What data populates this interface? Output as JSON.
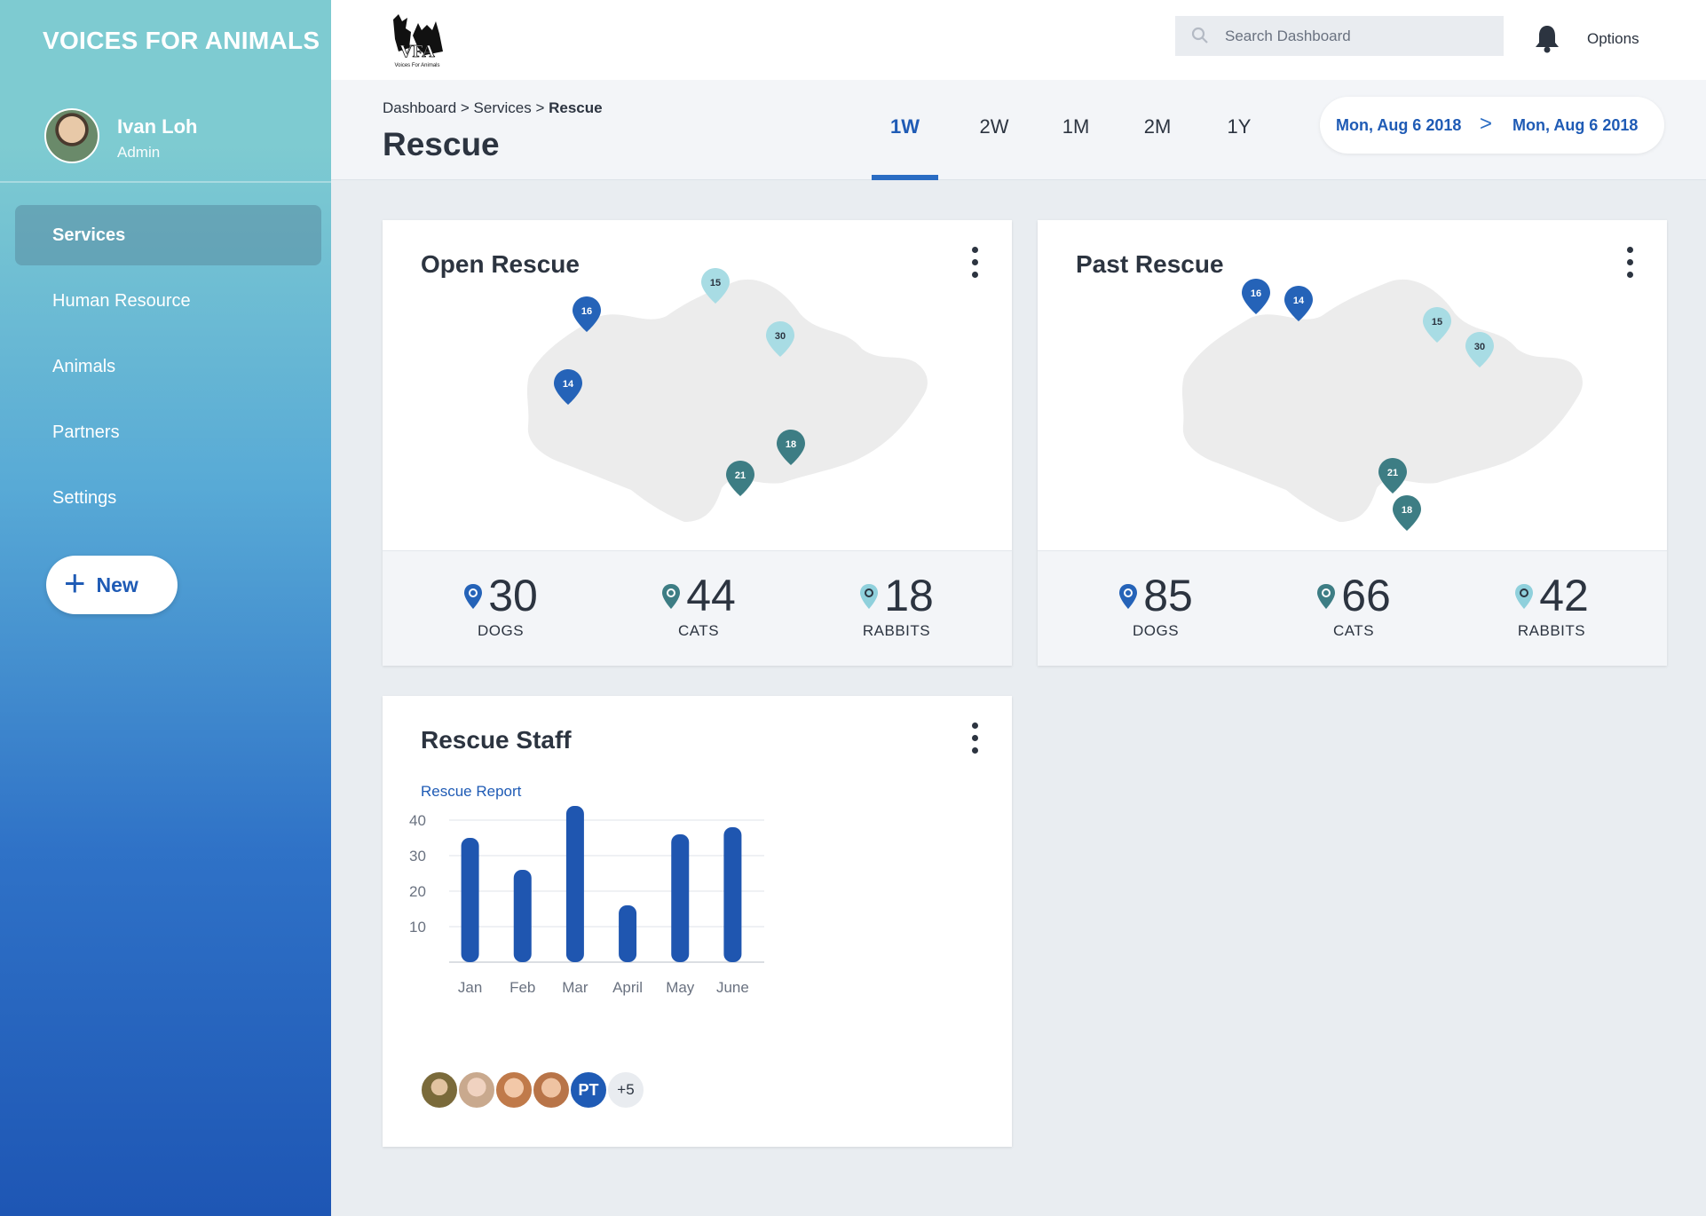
{
  "sidebar": {
    "brand": "VOICES FOR ANIMALS",
    "user": {
      "name": "Ivan Loh",
      "role": "Admin"
    },
    "items": [
      {
        "label": "Services",
        "active": true
      },
      {
        "label": "Human Resource",
        "active": false
      },
      {
        "label": "Animals",
        "active": false
      },
      {
        "label": "Partners",
        "active": false
      },
      {
        "label": "Settings",
        "active": false
      }
    ],
    "new_button": "New"
  },
  "topbar": {
    "logo_text": "Voices For Animals",
    "search_placeholder": "Search Dashboard",
    "options_label": "Options"
  },
  "header": {
    "breadcrumb": {
      "part1": "Dashboard > Services > ",
      "current": "Rescue"
    },
    "title": "Rescue",
    "tabs": [
      {
        "label": "1W",
        "active": true
      },
      {
        "label": "2W",
        "active": false
      },
      {
        "label": "1M",
        "active": false
      },
      {
        "label": "2M",
        "active": false
      },
      {
        "label": "1Y",
        "active": false
      }
    ],
    "date_from": "Mon, Aug 6  2018",
    "date_to": "Mon, Aug 6  2018"
  },
  "open_rescue": {
    "title": "Open Rescue",
    "pins": [
      "16",
      "15",
      "30",
      "14",
      "18",
      "21"
    ],
    "stats": [
      {
        "value": "30",
        "label": "DOGS",
        "color": "#2563b8"
      },
      {
        "value": "44",
        "label": "CATS",
        "color": "#3d7d84"
      },
      {
        "value": "18",
        "label": "RABBITS",
        "color": "#8fd0dc"
      }
    ]
  },
  "past_rescue": {
    "title": "Past Rescue",
    "pins": [
      "16",
      "14",
      "15",
      "30",
      "21",
      "18"
    ],
    "stats": [
      {
        "value": "85",
        "label": "DOGS",
        "color": "#2563b8"
      },
      {
        "value": "66",
        "label": "CATS",
        "color": "#3d7d84"
      },
      {
        "value": "42",
        "label": "RABBITS",
        "color": "#8fd0dc"
      }
    ]
  },
  "rescue_staff": {
    "title": "Rescue Staff",
    "report_label": "Rescue Report",
    "initials": "PT",
    "more_count": "+5"
  },
  "chart_data": {
    "type": "bar",
    "title": "Rescue Report",
    "categories": [
      "Jan",
      "Feb",
      "Mar",
      "April",
      "May",
      "June"
    ],
    "values": [
      35,
      26,
      44,
      16,
      36,
      38
    ],
    "yticks": [
      10,
      20,
      30,
      40
    ],
    "ylim": [
      0,
      45
    ],
    "bar_color": "#1f56b0",
    "grid": true
  },
  "colors": {
    "accent": "#1f5bb5",
    "pin_dog": "#2563b8",
    "pin_cat": "#3d7d84",
    "pin_rabbit": "#8fd0dc"
  }
}
